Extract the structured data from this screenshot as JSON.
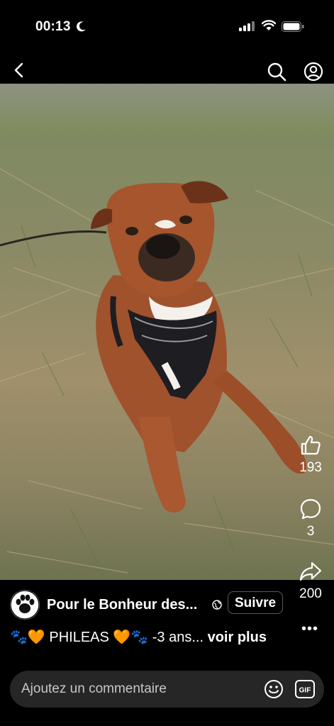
{
  "status_bar": {
    "time": "00:13"
  },
  "post": {
    "author": "Pour le Bonheur des...",
    "follow_label": "Suivre",
    "caption_text": "🐾🧡 PHILEAS 🧡🐾 -3 ans...",
    "caption_more": "voir plus",
    "likes": "193",
    "comments": "3",
    "shares": "200"
  },
  "comment_input": {
    "placeholder": "Ajoutez un commentaire",
    "gif_label": "GIF"
  },
  "colors": {
    "background": "#000000",
    "input_bg": "#262626",
    "text": "#ffffff"
  }
}
